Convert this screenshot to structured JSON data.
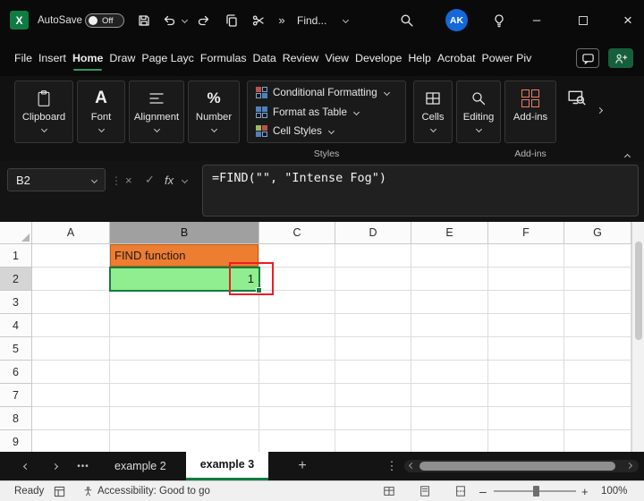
{
  "titlebar": {
    "autosave_label": "AutoSave",
    "autosave_state": "Off",
    "overflow_chevrons": "»",
    "find_label": "Find...",
    "avatar_initials": "AK",
    "minimize_glyph": "–",
    "close_glyph": "×"
  },
  "menubar": {
    "items": [
      "File",
      "Insert",
      "Home",
      "Draw",
      "Page Layc",
      "Formulas",
      "Data",
      "Review",
      "View",
      "Develope",
      "Help",
      "Acrobat",
      "Power Piv"
    ],
    "active_item": "Home"
  },
  "ribbon": {
    "clipboard_label": "Clipboard",
    "font_label": "Font",
    "alignment_label": "Alignment",
    "number_label": "Number",
    "number_glyph": "%",
    "font_glyph": "A",
    "conditional_formatting_label": "Conditional Formatting",
    "format_as_table_label": "Format as Table",
    "cell_styles_label": "Cell Styles",
    "styles_group_label": "Styles",
    "cells_label": "Cells",
    "editing_label": "Editing",
    "addins_label": "Add-ins",
    "addins_group_label": "Add-ins"
  },
  "formula_bar": {
    "name_box_value": "B2",
    "separator_dots": "⋮",
    "cancel_glyph": "×",
    "enter_glyph": "✓",
    "fx_label": "fx",
    "formula_text": "=FIND(\"\", \"Intense Fog\")"
  },
  "grid": {
    "column_headers": [
      "A",
      "B",
      "C",
      "D",
      "E",
      "F",
      "G"
    ],
    "row_headers": [
      "1",
      "2",
      "3",
      "4",
      "5",
      "6",
      "7",
      "8",
      "9"
    ],
    "selected_column": "B",
    "selected_row": "2",
    "cells": [
      {
        "ref": "B1",
        "text": "FIND function",
        "fill": "#ED7D31",
        "border": "#BF5B11",
        "align": "left"
      },
      {
        "ref": "B2",
        "text": "1",
        "fill": "#90EE90",
        "align": "right",
        "selected": true
      }
    ]
  },
  "sheet_tabs": {
    "overflow_label": "•••",
    "add_label": "+",
    "more_label": "⋮",
    "tabs": [
      {
        "label": "example 2",
        "active": false
      },
      {
        "label": "example 3",
        "active": true
      }
    ]
  },
  "status_bar": {
    "mode": "Ready",
    "accessibility": "Accessibility: Good to go",
    "zoom_level": "100%"
  },
  "colors": {
    "excel_green": "#107C41",
    "selection_green_fill": "#90EE90",
    "orange_fill": "#ED7D31",
    "annotation_red": "#EE1C25",
    "avatar_blue": "#1468D8"
  }
}
